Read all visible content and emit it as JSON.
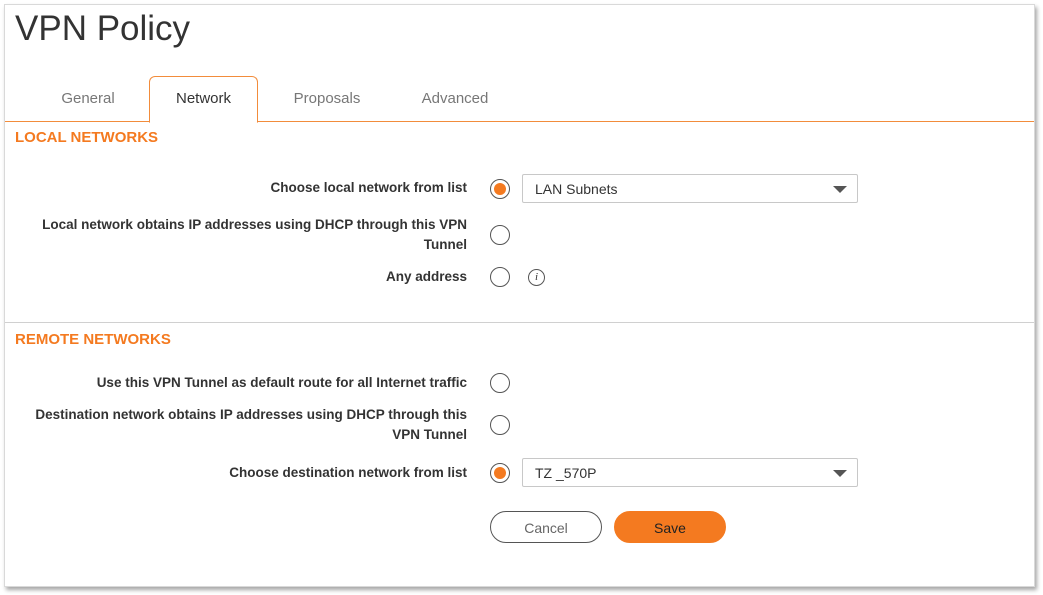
{
  "page": {
    "title": "VPN Policy"
  },
  "tabs": [
    {
      "label": "General",
      "active": false
    },
    {
      "label": "Network",
      "active": true
    },
    {
      "label": "Proposals",
      "active": false
    },
    {
      "label": "Advanced",
      "active": false
    }
  ],
  "local": {
    "heading": "LOCAL NETWORKS",
    "choose_label": "Choose local network from list",
    "choose_checked": true,
    "choose_value": "LAN Subnets",
    "dhcp_label": "Local network obtains IP addresses using DHCP through this VPN Tunnel",
    "dhcp_checked": false,
    "any_label": "Any address",
    "any_checked": false,
    "info_icon": "info-icon"
  },
  "remote": {
    "heading": "REMOTE NETWORKS",
    "default_route_label": "Use this VPN Tunnel as default route for all Internet traffic",
    "default_route_checked": false,
    "dhcp_label": "Destination network obtains IP addresses using DHCP through this VPN Tunnel",
    "dhcp_checked": false,
    "choose_label": "Choose destination network from list",
    "choose_checked": true,
    "choose_value": "TZ _570P"
  },
  "actions": {
    "cancel_label": "Cancel",
    "save_label": "Save"
  },
  "colors": {
    "accent": "#f47a20",
    "tab_border": "#f28c3b"
  }
}
